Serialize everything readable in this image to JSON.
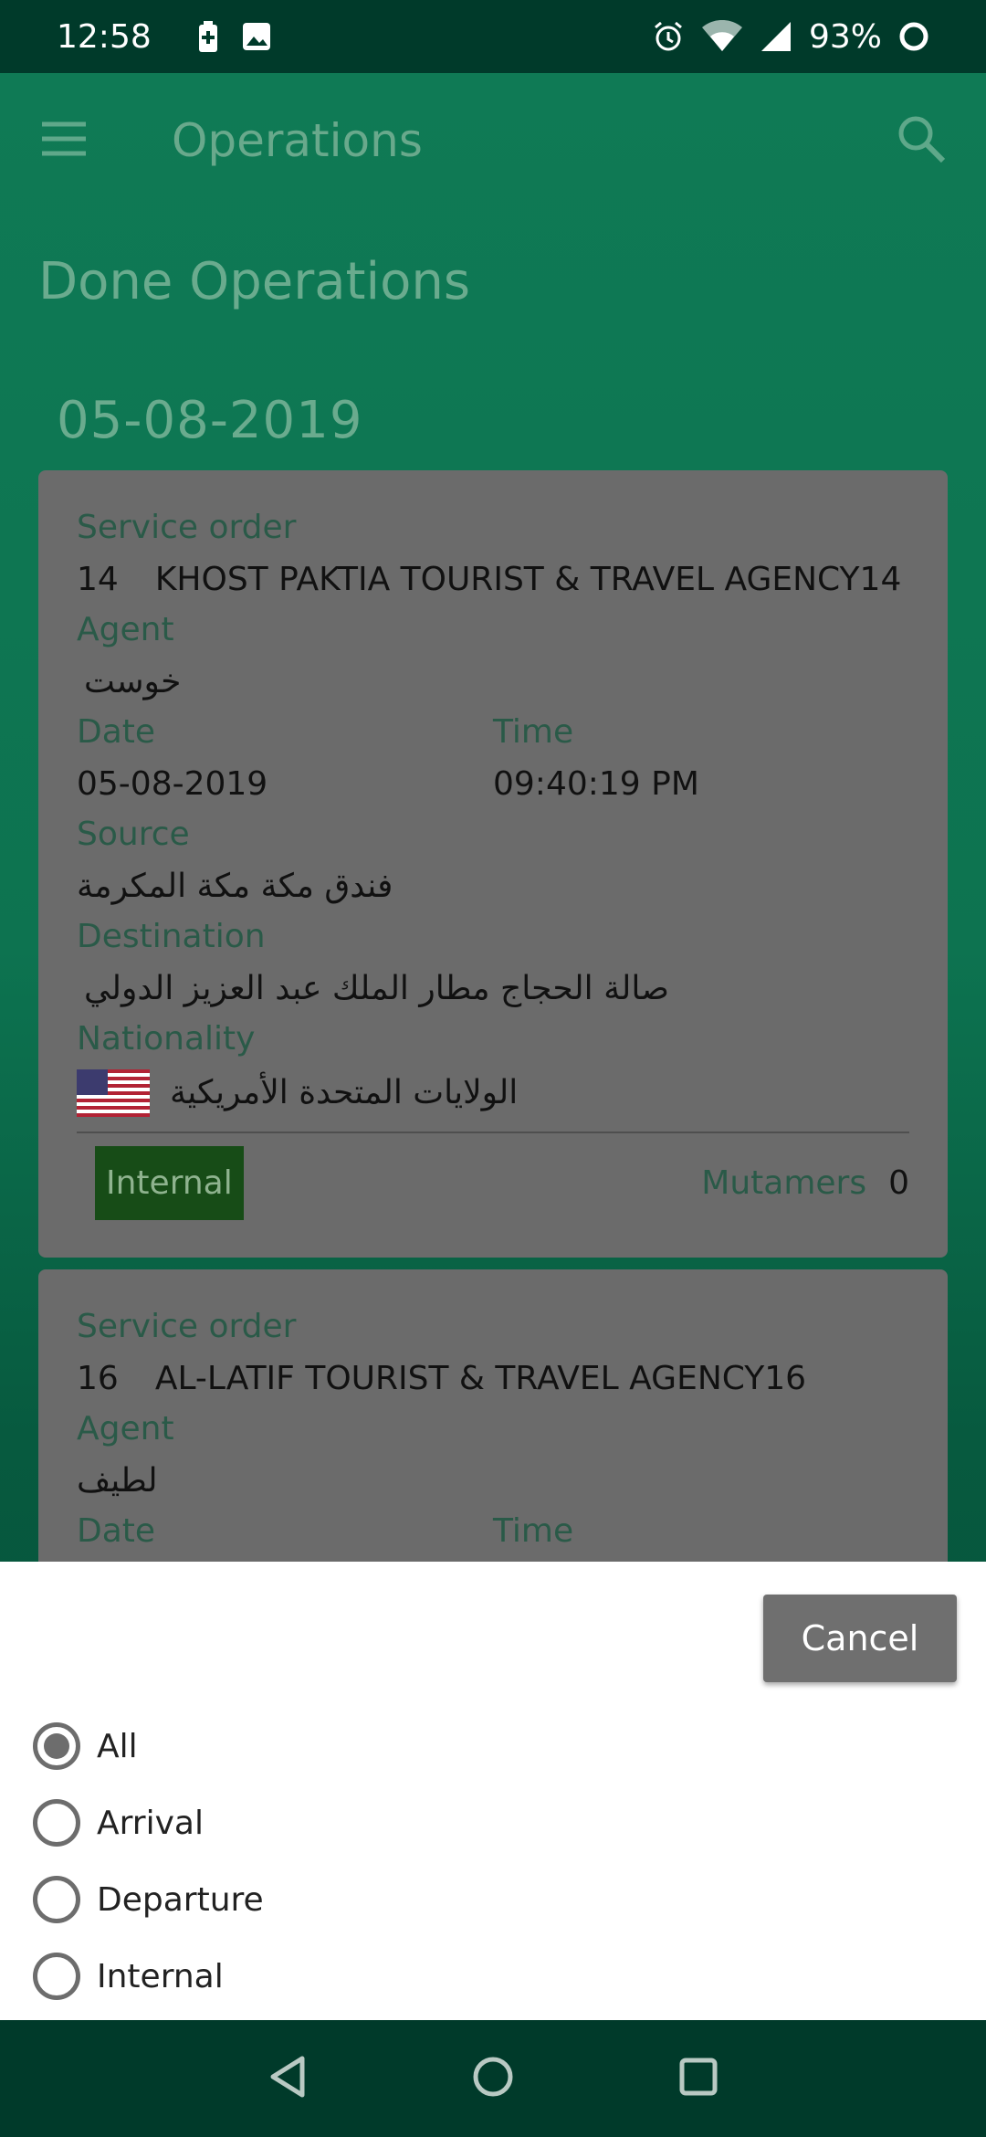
{
  "status_bar": {
    "time": "12:58",
    "battery": "93%"
  },
  "app_bar": {
    "title": "Operations"
  },
  "section_title": "Done Operations",
  "date_header": "05-08-2019",
  "labels": {
    "service_order": "Service order",
    "agent": "Agent",
    "date": "Date",
    "time": "Time",
    "source": "Source",
    "destination": "Destination",
    "nationality": "Nationality",
    "mutamers": "Mutamers"
  },
  "cards": [
    {
      "order_number": "14",
      "agency": "KHOST PAKTIA TOURIST & TRAVEL AGENCY14",
      "agent": "خوست",
      "date": "05-08-2019",
      "time": "09:40:19 PM",
      "source": "فندق مكة مكة المكرمة",
      "destination": "صالة الحجاج مطار الملك عبد العزيز الدولي",
      "nationality": "الولايات المتحدة الأمريكية",
      "type_badge": "Internal",
      "mutamers": "0"
    },
    {
      "order_number": "16",
      "agency": "AL-LATIF TOURIST & TRAVEL AGENCY16",
      "agent": "لطيف"
    }
  ],
  "filter_sheet": {
    "cancel_label": "Cancel",
    "options": [
      "All",
      "Arrival",
      "Departure",
      "Internal"
    ],
    "selected": "All"
  },
  "colors": {
    "primary_green": "#0f7a55",
    "status_bar": "#003a2a",
    "badge_green": "#174c17"
  }
}
